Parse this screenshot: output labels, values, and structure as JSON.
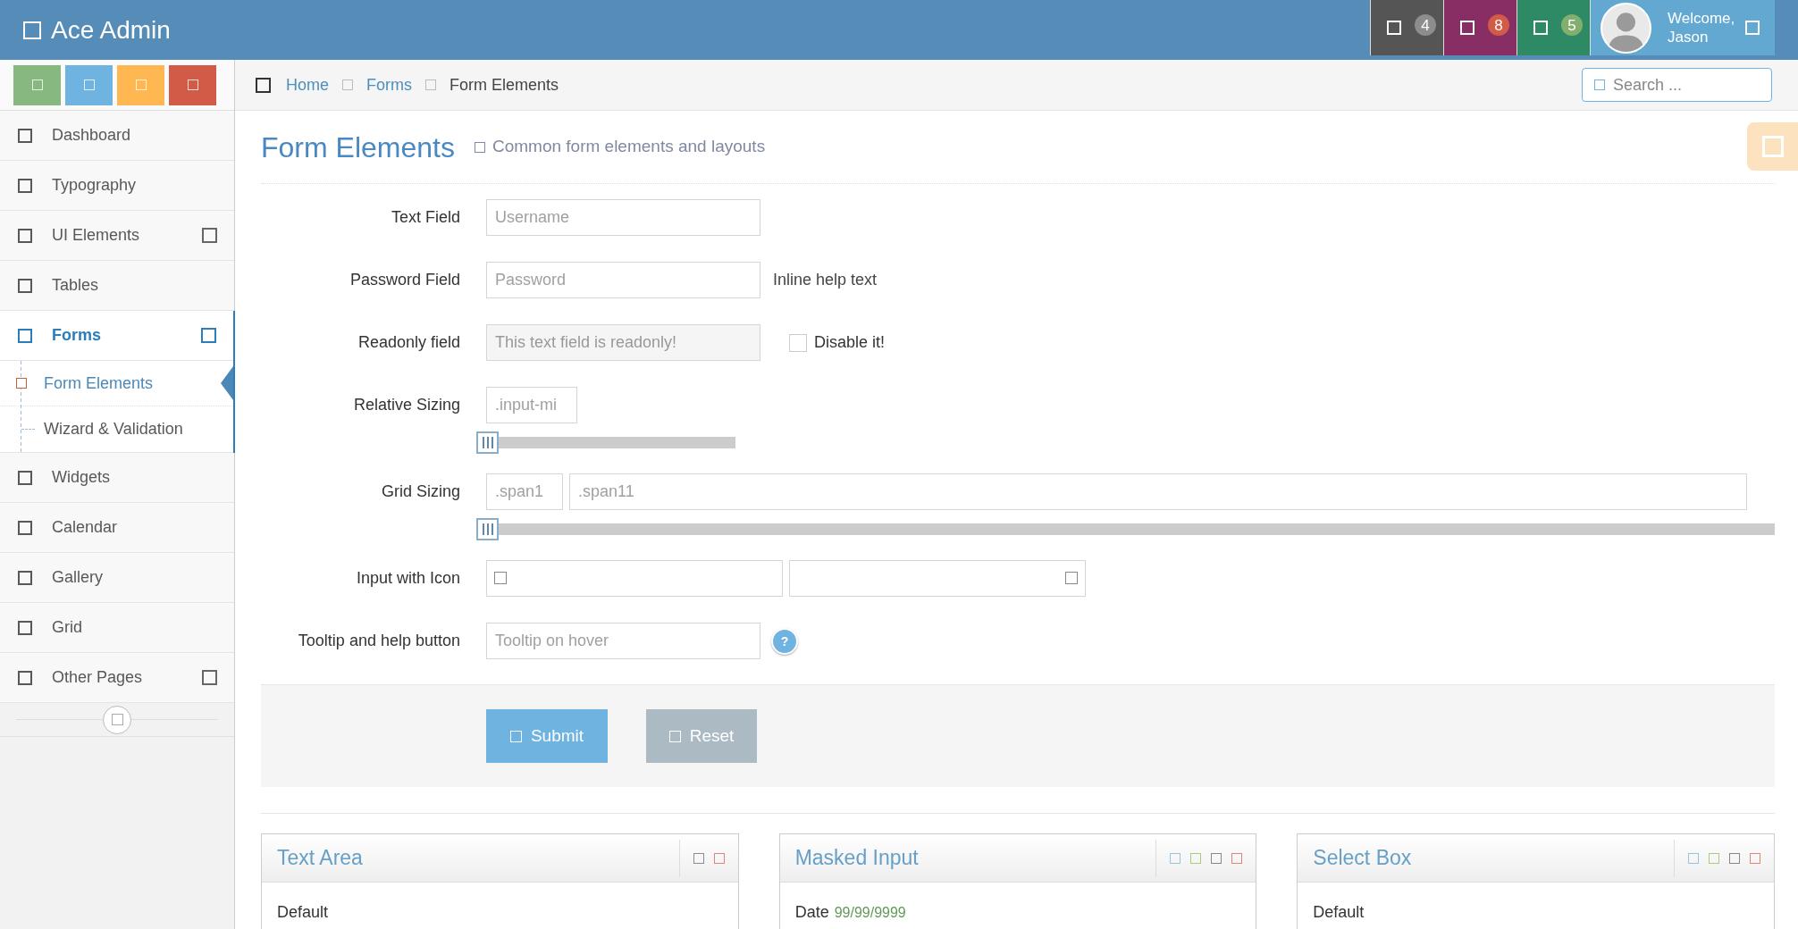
{
  "header": {
    "brand": "Ace Admin",
    "notifications": [
      {
        "color": "#555555",
        "badge": {
          "count": "4",
          "color": "#8d8d8d"
        }
      },
      {
        "color": "#892e65",
        "badge": {
          "count": "8",
          "color": "#d15b47"
        }
      },
      {
        "color": "#2e8965",
        "badge": {
          "count": "5",
          "color": "#82af6f"
        }
      }
    ],
    "user": {
      "greeting": "Welcome,",
      "name": "Jason"
    }
  },
  "sidebar": {
    "shortcuts": [
      {
        "color": "#87b87f"
      },
      {
        "color": "#6fb3e0"
      },
      {
        "color": "#ffb752"
      },
      {
        "color": "#d15b47"
      }
    ],
    "items": [
      {
        "label": "Dashboard",
        "selected": false,
        "submenu": false
      },
      {
        "label": "Typography",
        "selected": false,
        "submenu": false
      },
      {
        "label": "UI Elements",
        "selected": false,
        "submenu": true
      },
      {
        "label": "Tables",
        "selected": false,
        "submenu": false
      },
      {
        "label": "Forms",
        "selected": true,
        "submenu": true,
        "children": [
          {
            "label": "Form Elements",
            "selected": true
          },
          {
            "label": "Wizard & Validation",
            "selected": false
          }
        ]
      },
      {
        "label": "Widgets",
        "selected": false,
        "submenu": false
      },
      {
        "label": "Calendar",
        "selected": false,
        "submenu": false
      },
      {
        "label": "Gallery",
        "selected": false,
        "submenu": false
      },
      {
        "label": "Grid",
        "selected": false,
        "submenu": false
      },
      {
        "label": "Other Pages",
        "selected": false,
        "submenu": true
      }
    ]
  },
  "breadcrumb": [
    {
      "label": "Home",
      "current": false
    },
    {
      "label": "Forms",
      "current": false
    },
    {
      "label": "Form Elements",
      "current": true
    }
  ],
  "search": {
    "placeholder": "Search ..."
  },
  "page_header": {
    "title": "Form Elements",
    "subtitle": "Common form elements and layouts"
  },
  "form": {
    "rows": [
      {
        "kind": "text",
        "label": "Text Field",
        "placeholder": "Username"
      },
      {
        "kind": "password",
        "label": "Password Field",
        "placeholder": "Password",
        "help": "Inline help text"
      },
      {
        "kind": "readonly",
        "label": "Readonly field",
        "value": "This text field is readonly!",
        "checkbox": {
          "label": "Disable it!",
          "checked": false
        }
      },
      {
        "kind": "relative_sizing",
        "label": "Relative Sizing",
        "fields": [
          {
            "placeholder": ".input-mi"
          }
        ],
        "slider": {
          "level": 0
        }
      },
      {
        "kind": "grid_sizing",
        "label": "Grid Sizing",
        "fields": [
          {
            "placeholder": ".span1"
          },
          {
            "placeholder": ".span11"
          }
        ],
        "slider": {
          "level": 0
        }
      },
      {
        "kind": "icon_inputs",
        "label": "Input with Icon",
        "fields": [
          {
            "kind": "leading_icon"
          },
          {
            "kind": "trailing_icon"
          }
        ]
      },
      {
        "kind": "help",
        "label": "Tooltip and help button",
        "placeholder": "Tooltip on hover",
        "button": "?"
      }
    ],
    "actions": [
      {
        "label": "Submit",
        "kind": "primary"
      },
      {
        "label": "Reset",
        "kind": "secondary"
      }
    ]
  },
  "widgets": [
    {
      "title": "Text Area",
      "tools": [
        {
          "color": "#8d8d8d"
        },
        {
          "color": "#e0857a"
        }
      ],
      "body": {
        "label": "Default"
      }
    },
    {
      "title": "Masked Input",
      "tools": [
        {
          "color": "#9cc3dd"
        },
        {
          "color": "#a6cf7b"
        },
        {
          "color": "#888888"
        },
        {
          "color": "#e0857a"
        }
      ],
      "body": {
        "label": "Date",
        "hint": "99/99/9999"
      }
    },
    {
      "title": "Select Box",
      "tools": [
        {
          "color": "#9cc3dd"
        },
        {
          "color": "#a6cf7b"
        },
        {
          "color": "#888888"
        },
        {
          "color": "#e0857a"
        }
      ],
      "body": {
        "label": "Default"
      }
    }
  ]
}
